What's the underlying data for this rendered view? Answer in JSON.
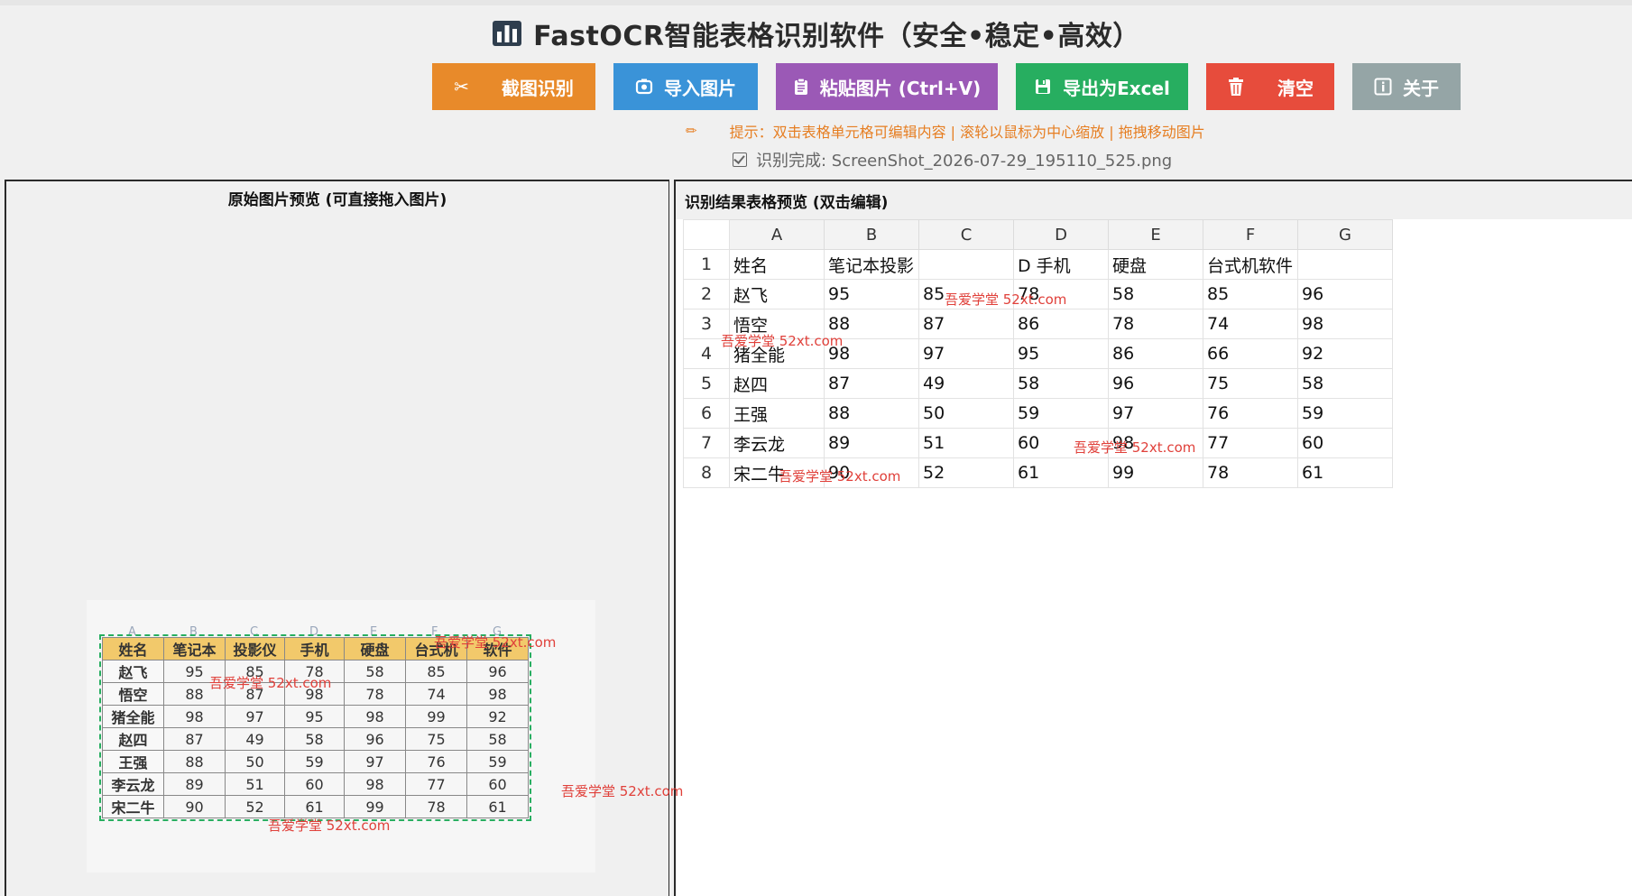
{
  "app": {
    "title": "FastOCR智能表格识别软件（安全•稳定•高效）"
  },
  "toolbar": {
    "screenshot_label": "截图识别",
    "import_label": "导入图片",
    "paste_label": "粘贴图片 (Ctrl+V)",
    "export_label": "导出为Excel",
    "clear_label": "清空",
    "about_label": "关于"
  },
  "hint": "提示：双击表格单元格可编辑内容 | 滚轮以鼠标为中心缩放 | 拖拽移动图片",
  "status": "识别完成: ScreenShot_2026-07-29_195110_525.png",
  "left_panel": {
    "title": "原始图片预览 (可直接拖入图片)",
    "preview": {
      "col_letters": [
        "A",
        "B",
        "C",
        "D",
        "E",
        "F",
        "G"
      ],
      "header": [
        "姓名",
        "笔记本",
        "投影仪",
        "手机",
        "硬盘",
        "台式机",
        "软件"
      ],
      "rows": [
        [
          "赵飞",
          "95",
          "85",
          "78",
          "58",
          "85",
          "96"
        ],
        [
          "悟空",
          "88",
          "87",
          "98",
          "78",
          "74",
          "98"
        ],
        [
          "猪全能",
          "98",
          "97",
          "95",
          "98",
          "99",
          "92"
        ],
        [
          "赵四",
          "87",
          "49",
          "58",
          "96",
          "75",
          "58"
        ],
        [
          "王强",
          "88",
          "50",
          "59",
          "97",
          "76",
          "59"
        ],
        [
          "李云龙",
          "89",
          "51",
          "60",
          "98",
          "77",
          "60"
        ],
        [
          "宋二牛",
          "90",
          "52",
          "61",
          "99",
          "78",
          "61"
        ]
      ]
    }
  },
  "right_panel": {
    "title": "识别结果表格预览 (双击编辑)",
    "columns": [
      "A",
      "B",
      "C",
      "D",
      "E",
      "F",
      "G"
    ],
    "row_numbers": [
      "1",
      "2",
      "3",
      "4",
      "5",
      "6",
      "7",
      "8"
    ],
    "rows": [
      [
        "姓名",
        "笔记本投影",
        "",
        "D 手机",
        "硬盘",
        "台式机软件",
        ""
      ],
      [
        "赵飞",
        "95",
        "85",
        "78",
        "58",
        "85",
        "96"
      ],
      [
        "悟空",
        "88",
        "87",
        "86",
        "78",
        "74",
        "98"
      ],
      [
        "猪全能",
        "98",
        "97",
        "95",
        "86",
        "66",
        "92"
      ],
      [
        "赵四",
        "87",
        "49",
        "58",
        "96",
        "75",
        "58"
      ],
      [
        "王强",
        "88",
        "50",
        "59",
        "97",
        "76",
        "59"
      ],
      [
        "李云龙",
        "89",
        "51",
        "60",
        "98",
        "77",
        "60"
      ],
      [
        "宋二牛",
        "90",
        "52",
        "61",
        "99",
        "78",
        "61"
      ]
    ]
  },
  "watermark": "吾爱学堂 52xt.com",
  "colors": {
    "screenshot": "#e88a2a",
    "import": "#3a93d8",
    "paste": "#9b59b6",
    "export": "#27ae60",
    "clear": "#e74c3c",
    "about": "#95a5a6",
    "hint": "#e67e22"
  }
}
